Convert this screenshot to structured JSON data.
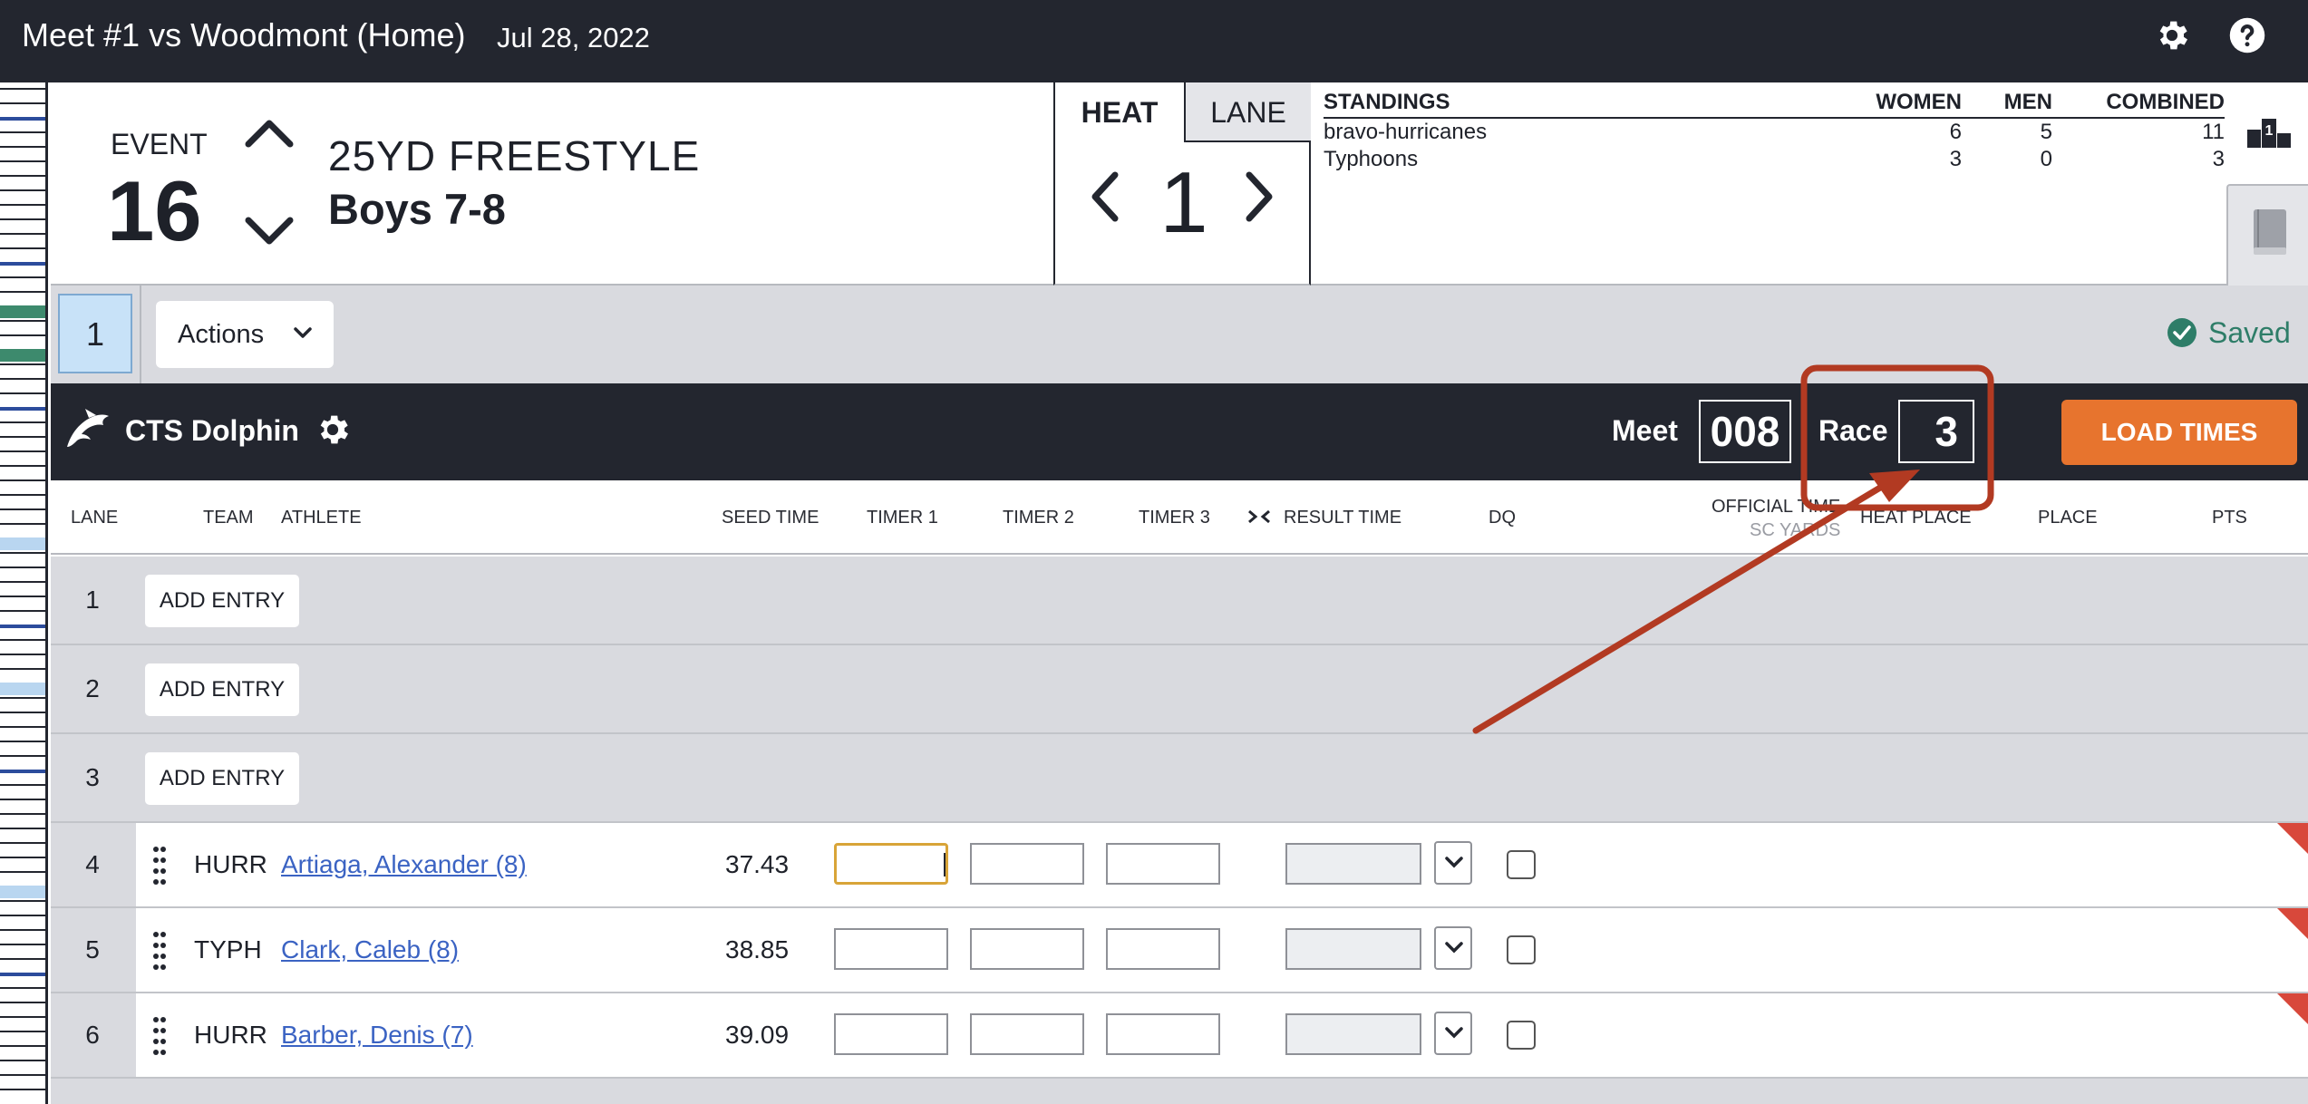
{
  "topbar": {
    "title": "Meet #1 vs Woodmont (Home)",
    "date": "Jul 28, 2022",
    "settings_icon": "gear-icon",
    "help_icon": "help-icon"
  },
  "event": {
    "label": "EVENT",
    "number": "16",
    "name": "25YD FREESTYLE",
    "group": "Boys 7-8"
  },
  "heat": {
    "tab_heat": "HEAT",
    "tab_lane": "LANE",
    "number": "1"
  },
  "standings": {
    "headers": [
      "STANDINGS",
      "WOMEN",
      "MEN",
      "COMBINED"
    ],
    "rows": [
      {
        "team": "bravo-hurricanes",
        "women": "6",
        "men": "5",
        "combined": "11"
      },
      {
        "team": "Typhoons",
        "women": "3",
        "men": "0",
        "combined": "3"
      }
    ]
  },
  "toolbar": {
    "heat_chip": "1",
    "actions_label": "Actions",
    "saved_label": "Saved"
  },
  "timing": {
    "system_name": "CTS Dolphin",
    "meet_label": "Meet",
    "meet_value": "008",
    "race_label": "Race",
    "race_value": "3",
    "load_button": "LOAD TIMES"
  },
  "columns": {
    "lane": "LANE",
    "team": "TEAM",
    "athlete": "ATHLETE",
    "seed": "SEED TIME",
    "timer1": "TIMER 1",
    "timer2": "TIMER 2",
    "timer3": "TIMER 3",
    "result": "RESULT TIME",
    "dq": "DQ",
    "official": "OFFICIAL TIME",
    "official_sub": "SC YARDS",
    "heat_place": "HEAT PLACE",
    "place": "PLACE",
    "pts": "PTS"
  },
  "empty_lanes": [
    {
      "lane": "1",
      "button": "ADD ENTRY"
    },
    {
      "lane": "2",
      "button": "ADD ENTRY"
    },
    {
      "lane": "3",
      "button": "ADD ENTRY"
    }
  ],
  "entries": [
    {
      "lane": "4",
      "team": "HURR",
      "athlete": "Artiaga, Alexander (8)",
      "seed": "37.43"
    },
    {
      "lane": "5",
      "team": "TYPH",
      "athlete": "Clark, Caleb (8)",
      "seed": "38.85"
    },
    {
      "lane": "6",
      "team": "HURR",
      "athlete": "Barber, Denis (7)",
      "seed": "39.09"
    }
  ],
  "colors": {
    "dark_bar": "#23262f",
    "load_button": "#e7742e",
    "saved_green": "#2e7d68",
    "link_blue": "#3b63c3",
    "annotation_red": "#b23a22"
  }
}
